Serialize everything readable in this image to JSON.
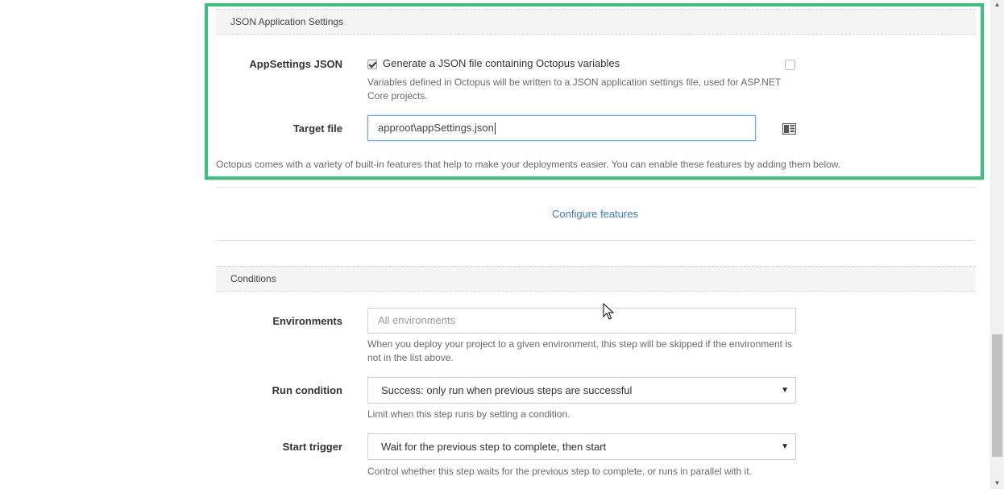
{
  "json_settings": {
    "header": "JSON Application Settings",
    "appsettings_label": "AppSettings JSON",
    "appsettings_checkbox_label": "Generate a JSON file containing Octopus variables",
    "appsettings_checked": true,
    "appsettings_help": "Variables defined in Octopus will be written to a JSON application settings file, used for ASP.NET Core projects.",
    "target_file_label": "Target file",
    "target_file_value": "approot\\appSettings.json",
    "features_note": "Octopus comes with a variety of built-in features that help to make your deployments easier. You can enable these features by adding them below.",
    "highlight_color": "#3cbf7f"
  },
  "features": {
    "configure_link": "Configure features"
  },
  "conditions": {
    "header": "Conditions",
    "environments_label": "Environments",
    "environments_placeholder": "All environments",
    "environments_help": "When you deploy your project to a given environment, this step will be skipped if the environment is not in the list above.",
    "run_condition_label": "Run condition",
    "run_condition_value": "Success: only run when previous steps are successful",
    "run_condition_help": "Limit when this step runs by setting a condition.",
    "start_trigger_label": "Start trigger",
    "start_trigger_value": "Wait for the previous step to complete, then start",
    "start_trigger_help": "Control whether this step waits for the previous step to complete, or runs in parallel with it."
  },
  "icons": {
    "variable_insert": "variable-insert-icon",
    "dropdown": "dropdown-arrow-icon",
    "cursor": "mouse-pointer-icon"
  }
}
